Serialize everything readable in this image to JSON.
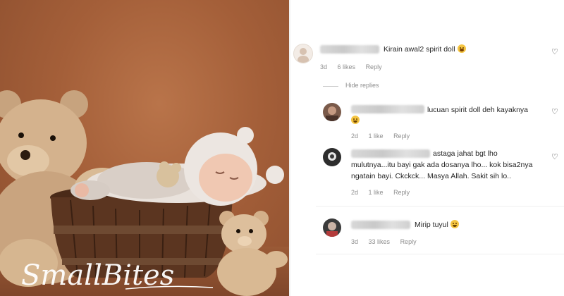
{
  "photo": {
    "watermark": "SmallBites"
  },
  "comments": [
    {
      "text": "Kirain awal2 spirit doll",
      "emoji": "crying-laughing-emoji",
      "time": "3d",
      "likes": "6 likes",
      "reply": "Reply"
    },
    {
      "text": "lucuan spirit doll deh kayaknya",
      "emoji": "laughing-emoji",
      "time": "2d",
      "likes": "1 like",
      "reply": "Reply"
    },
    {
      "text_line1": "astaga jahat bgt lho",
      "text_line2": "mulutnya...itu bayi gak ada dosanya lho... kok bisa2nya",
      "text_line3": "ngatain bayi. Ckckck... Masya Allah. Sakit sih lo..",
      "time": "2d",
      "likes": "1 like",
      "reply": "Reply"
    },
    {
      "text": "Mirip tuyul",
      "emoji": "laughing-emoji",
      "time": "3d",
      "likes": "33 likes",
      "reply": "Reply"
    }
  ],
  "hide_replies": "Hide replies",
  "icons": {
    "like": "heart-outline-icon"
  },
  "colors": {
    "text": "#262626",
    "meta": "#8e8e8e",
    "background_photo": "#a45f39"
  }
}
